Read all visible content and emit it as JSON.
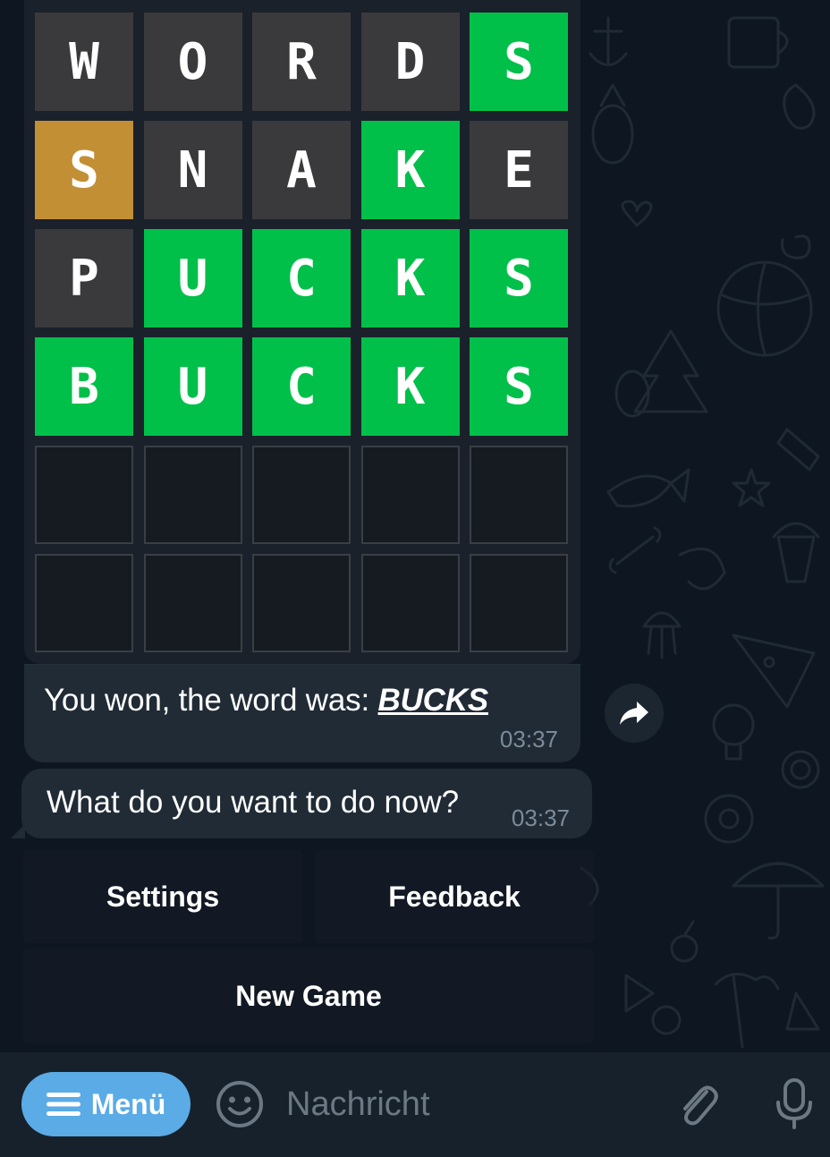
{
  "board": {
    "rows": [
      [
        {
          "l": "W",
          "s": "absent"
        },
        {
          "l": "O",
          "s": "absent"
        },
        {
          "l": "R",
          "s": "absent"
        },
        {
          "l": "D",
          "s": "absent"
        },
        {
          "l": "S",
          "s": "correct"
        }
      ],
      [
        {
          "l": "S",
          "s": "present"
        },
        {
          "l": "N",
          "s": "absent"
        },
        {
          "l": "A",
          "s": "absent"
        },
        {
          "l": "K",
          "s": "correct"
        },
        {
          "l": "E",
          "s": "absent"
        }
      ],
      [
        {
          "l": "P",
          "s": "absent"
        },
        {
          "l": "U",
          "s": "correct"
        },
        {
          "l": "C",
          "s": "correct"
        },
        {
          "l": "K",
          "s": "correct"
        },
        {
          "l": "S",
          "s": "correct"
        }
      ],
      [
        {
          "l": "B",
          "s": "correct"
        },
        {
          "l": "U",
          "s": "correct"
        },
        {
          "l": "C",
          "s": "correct"
        },
        {
          "l": "K",
          "s": "correct"
        },
        {
          "l": "S",
          "s": "correct"
        }
      ],
      [
        {
          "l": "",
          "s": "empty"
        },
        {
          "l": "",
          "s": "empty"
        },
        {
          "l": "",
          "s": "empty"
        },
        {
          "l": "",
          "s": "empty"
        },
        {
          "l": "",
          "s": "empty"
        }
      ],
      [
        {
          "l": "",
          "s": "empty"
        },
        {
          "l": "",
          "s": "empty"
        },
        {
          "l": "",
          "s": "empty"
        },
        {
          "l": "",
          "s": "empty"
        },
        {
          "l": "",
          "s": "empty"
        }
      ]
    ]
  },
  "messages": {
    "won": {
      "prefix": "You won, the word was: ",
      "word": "BUCKS",
      "time": "03:37"
    },
    "ask": {
      "text": "What do you want to do now?",
      "time": "03:37"
    }
  },
  "keyboard": {
    "settings": "Settings",
    "feedback": "Feedback",
    "new_game": "New Game"
  },
  "input_bar": {
    "menu_label": "Menü",
    "placeholder": "Nachricht"
  },
  "colors": {
    "correct": "#00c04a",
    "present": "#c38f35",
    "absent": "#3a3a3c",
    "accent": "#5aabe6",
    "background": "#0e1621"
  },
  "icons": {
    "forward": "forward-arrow-icon",
    "menu": "hamburger-icon",
    "emoji": "smiley-icon",
    "attach": "paperclip-icon",
    "mic": "microphone-icon"
  }
}
